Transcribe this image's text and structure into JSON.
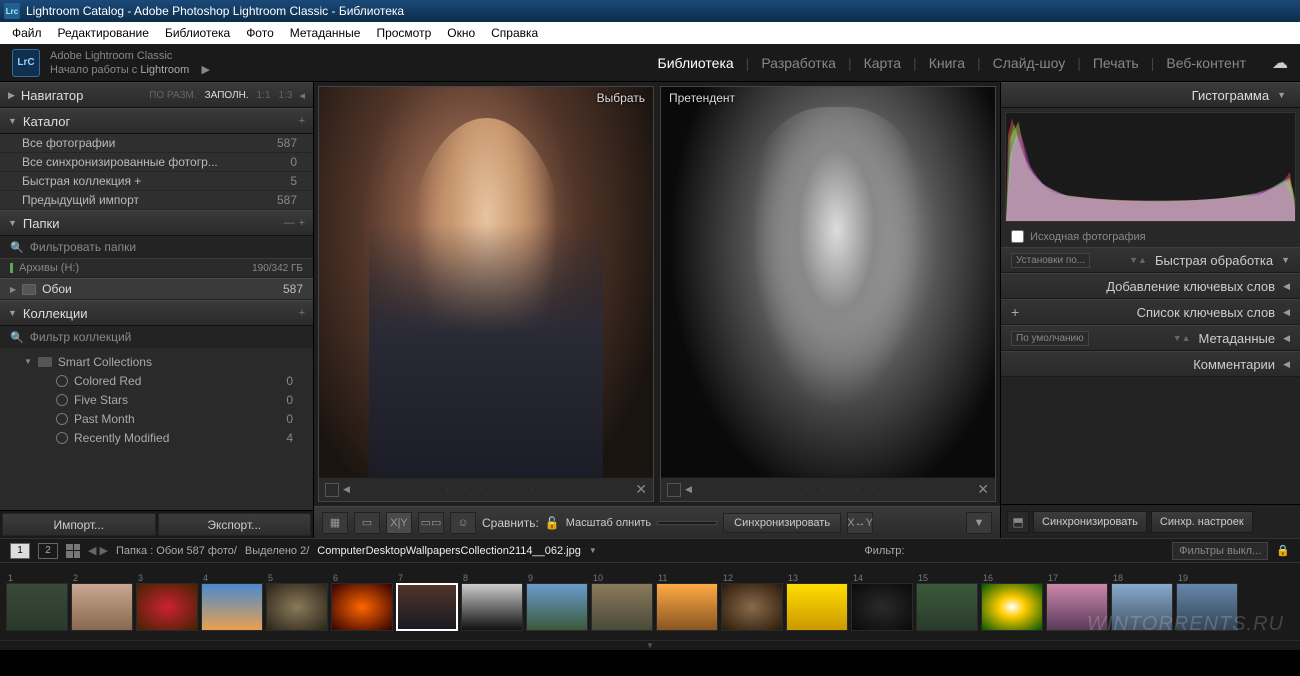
{
  "title": "Lightroom Catalog - Adobe Photoshop Lightroom Classic - Библиотека",
  "menubar": [
    "Файл",
    "Редактирование",
    "Библиотека",
    "Фото",
    "Метаданные",
    "Просмотр",
    "Окно",
    "Справка"
  ],
  "identity": {
    "line1": "Adobe Lightroom Classic",
    "line2_a": "Начало работы с ",
    "line2_b": "Lightroom"
  },
  "modules": [
    {
      "label": "Библиотека",
      "active": true
    },
    {
      "label": "Разработка",
      "active": false
    },
    {
      "label": "Карта",
      "active": false
    },
    {
      "label": "Книга",
      "active": false
    },
    {
      "label": "Слайд-шоу",
      "active": false
    },
    {
      "label": "Печать",
      "active": false
    },
    {
      "label": "Веб-контент",
      "active": false
    }
  ],
  "navigator": {
    "title": "Навигатор",
    "opts": [
      "ПО РАЗМ.",
      "ЗАПОЛН.",
      "1:1",
      "1:3"
    ],
    "active": 1
  },
  "catalog": {
    "title": "Каталог",
    "items": [
      {
        "label": "Все фотографии",
        "count": "587"
      },
      {
        "label": "Все синхронизированные фотогр...",
        "count": "0"
      },
      {
        "label": "Быстрая коллекция  +",
        "count": "5"
      },
      {
        "label": "Предыдущий импорт",
        "count": "587"
      }
    ]
  },
  "folders": {
    "title": "Папки",
    "filter_placeholder": "Фильтровать папки",
    "volume": {
      "name": "Архивы (H:)",
      "size": "190/342 ГБ"
    },
    "folder": {
      "name": "Обои",
      "count": "587"
    }
  },
  "collections": {
    "title": "Коллекции",
    "filter_placeholder": "Фильтр коллекций",
    "smart": "Smart Collections",
    "items": [
      {
        "label": "Colored Red",
        "count": "0"
      },
      {
        "label": "Five Stars",
        "count": "0"
      },
      {
        "label": "Past Month",
        "count": "0"
      },
      {
        "label": "Recently Modified",
        "count": "4"
      }
    ]
  },
  "import_btn": "Импорт...",
  "export_btn": "Экспорт...",
  "compare": {
    "select_label": "Выбрать",
    "candidate_label": "Претендент",
    "compare_label": "Сравнить:",
    "zoom_label": "Масштаб  олнить",
    "sync_btn": "Синхронизировать"
  },
  "right": {
    "histogram": "Гистограмма",
    "original_photo": "Исходная фотография",
    "preset_dd": "Установки по...",
    "quick_dev": "Быстрая обработка",
    "keywording": "Добавление ключевых слов",
    "keyword_list": "Список ключевых слов",
    "meta_dd": "По умолчанию",
    "metadata": "Метаданные",
    "comments": "Комментарии",
    "sync_btn": "Синхронизировать",
    "sync_settings": "Синхр. настроек"
  },
  "filmstrip": {
    "path_label": "Папка : Обои  587 фото/",
    "selected": "Выделено 2/",
    "filename": "ComputerDesktopWallpapersCollection2114__062.jpg",
    "filter_label": "Фильтр:",
    "filter_dd": "Фильтры выкл...",
    "monitors": [
      "1",
      "2"
    ],
    "thumbs": [
      {
        "num": "1",
        "bg": "linear-gradient(#3a4a3a,#2a3a2a)"
      },
      {
        "num": "2",
        "bg": "linear-gradient(#c8a890,#8a6850)"
      },
      {
        "num": "3",
        "bg": "radial-gradient(#cc2233,#420)"
      },
      {
        "num": "4",
        "bg": "linear-gradient(#4a8acc,#e8a050)"
      },
      {
        "num": "5",
        "bg": "radial-gradient(#8a7a5a,#2a2418)"
      },
      {
        "num": "6",
        "bg": "radial-gradient(#ff6600,#330000)"
      },
      {
        "num": "7",
        "bg": "linear-gradient(#503428,#1a1a25)",
        "sel": true
      },
      {
        "num": "8",
        "bg": "linear-gradient(#ccc,#111)"
      },
      {
        "num": "9",
        "bg": "linear-gradient(#6a9acc,#3a5a3a)"
      },
      {
        "num": "10",
        "bg": "linear-gradient(#8a7a5a,#4a4a3a)"
      },
      {
        "num": "11",
        "bg": "linear-gradient(#ffaa44,#885522)"
      },
      {
        "num": "12",
        "bg": "radial-gradient(#8a6a4a,#2a1a0a)"
      },
      {
        "num": "13",
        "bg": "linear-gradient(#ffdd00,#cc9900)"
      },
      {
        "num": "14",
        "bg": "radial-gradient(#2a2a2a,#0a0a0a)"
      },
      {
        "num": "15",
        "bg": "linear-gradient(#3a5a3a,#2a3a2a)"
      },
      {
        "num": "16",
        "bg": "radial-gradient(#fff,#ffcc00 30%,#050)"
      },
      {
        "num": "17",
        "bg": "linear-gradient(#cc88aa,#5a3a5a)"
      },
      {
        "num": "18",
        "bg": "linear-gradient(#88aacc,#445566)"
      },
      {
        "num": "19",
        "bg": "linear-gradient(#6688aa,#334455)"
      }
    ]
  },
  "watermark": "WINTORRENTS.RU"
}
